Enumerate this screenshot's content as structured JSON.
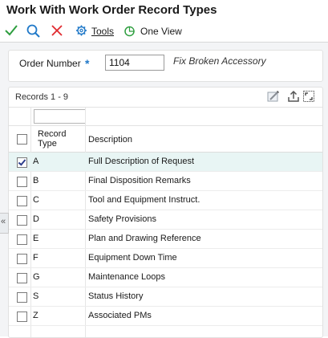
{
  "window": {
    "title": "Work With Work Order Record Types"
  },
  "toolbar": {
    "ok_icon": "checkmark-icon",
    "find_icon": "search-icon",
    "close_icon": "close-x-icon",
    "tools_label": "Tools",
    "oneview_label": "One View",
    "accent_color": "#1f78c8",
    "ok_color": "#2e9e3f",
    "close_color": "#e0282e"
  },
  "form": {
    "order_label": "Order Number",
    "required_marker": "*",
    "order_value": "1104",
    "order_description": "Fix Broken Accessory"
  },
  "grid": {
    "records_label": "Records 1 - 9",
    "filter_placeholder": "",
    "columns": {
      "record_type": "Record Type",
      "description": "Description"
    },
    "rows": [
      {
        "type": "A",
        "description": "Full Description of Request",
        "selected": true
      },
      {
        "type": "B",
        "description": "Final Disposition Remarks",
        "selected": false
      },
      {
        "type": "C",
        "description": "Tool and Equipment Instruct.",
        "selected": false
      },
      {
        "type": "D",
        "description": "Safety Provisions",
        "selected": false
      },
      {
        "type": "E",
        "description": "Plan and Drawing Reference",
        "selected": false
      },
      {
        "type": "F",
        "description": "Equipment Down Time",
        "selected": false
      },
      {
        "type": "G",
        "description": "Maintenance Loops",
        "selected": false
      },
      {
        "type": "S",
        "description": "Status History",
        "selected": false
      },
      {
        "type": "Z",
        "description": "Associated PMs",
        "selected": false
      }
    ],
    "selected_row_color": "#e8f5f4"
  },
  "side": {
    "collapse_glyph": "«"
  }
}
